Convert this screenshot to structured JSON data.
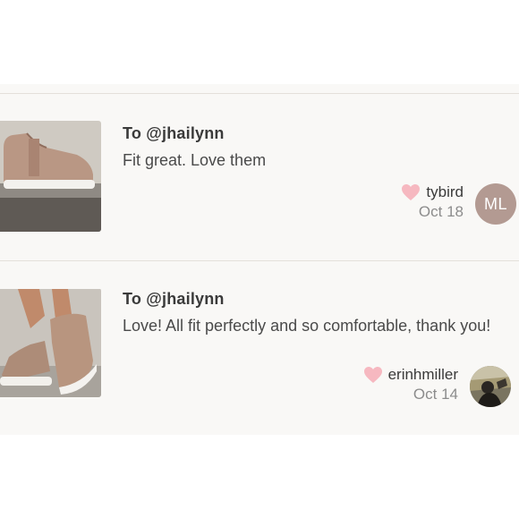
{
  "colors": {
    "heart": "#f6b8c0",
    "avatar_bg": "#b39a92",
    "divider": "#e4e0da",
    "feed_bg": "#f9f8f6"
  },
  "reviews": [
    {
      "recipient": "To @jhailynn",
      "comment": "Fit great. Love them",
      "username": "tybird",
      "date": "Oct 18",
      "avatar_initials": "ML",
      "icon": "heart-icon"
    },
    {
      "recipient": "To @jhailynn",
      "comment": "Love! All fit perfectly and so comfortable, thank you!",
      "username": "erinhmiller",
      "date": "Oct 14",
      "icon": "heart-icon"
    }
  ]
}
